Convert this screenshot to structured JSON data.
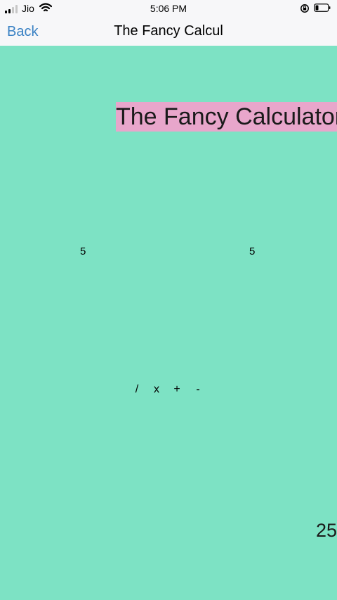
{
  "status_bar": {
    "carrier": "Jio",
    "time": "5:06 PM",
    "icons": [
      "signal-icon",
      "wifi-icon",
      "orientation-lock-icon",
      "battery-icon"
    ]
  },
  "nav_bar": {
    "back_label": "Back",
    "title": "The Fancy Calcul",
    "accent_color": "#3b82c4"
  },
  "main": {
    "title": "The Fancy Calculator",
    "title_background": "#e8a6cb",
    "background": "#7de2c4",
    "operand_1": "5",
    "operand_2": "5",
    "operators": [
      "/",
      "x",
      "+",
      "-"
    ],
    "result": "25"
  }
}
